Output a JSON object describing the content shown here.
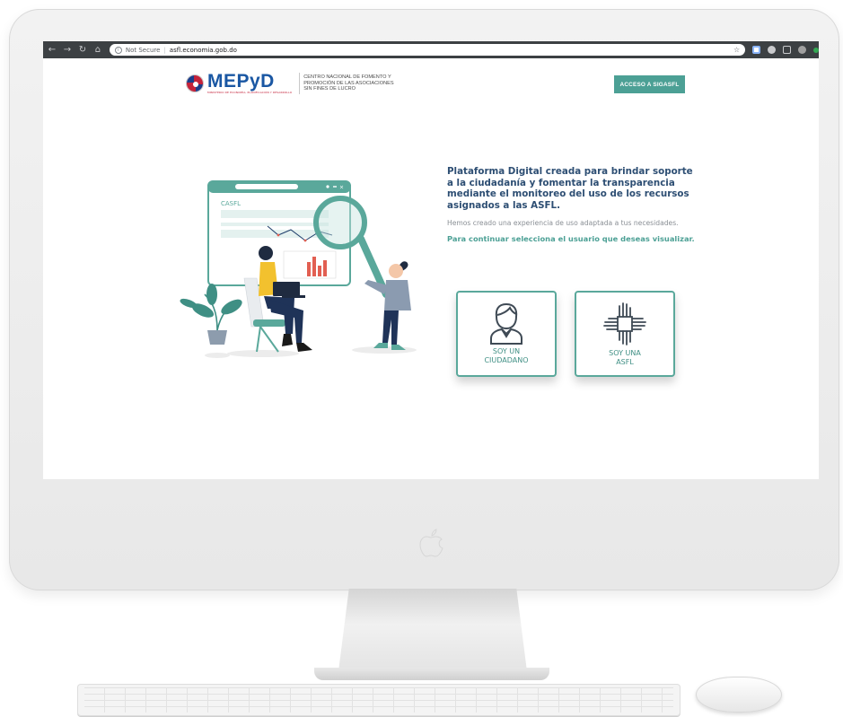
{
  "browser": {
    "security": "Not Secure",
    "url": "asfl.economia.gob.do",
    "nav_icons": [
      "back-arrow-icon",
      "forward-arrow-icon",
      "reload-icon",
      "home-icon"
    ]
  },
  "header": {
    "brand_name": "MEPyD",
    "brand_sub": "MINISTERIO DE ECONOMÍA, PLANIFICACIÓN Y DESARROLLO",
    "centro_lines": [
      "CENTRO NACIONAL DE FOMENTO Y",
      "PROMOCIÓN DE LAS ASOCIACIONES",
      "SIN FINES DE LUCRO"
    ],
    "acceso_label": "ACCESO A SIGASFL"
  },
  "illustration": {
    "window_label": "CASFL"
  },
  "main": {
    "headline": "Plataforma Digital creada para brindar soporte a la ciudadanía y fomentar la transparencia mediante el monitoreo del uso de los recursos asignados a las ASFL.",
    "description": "Hemos creado una experiencia de uso adaptada a tus necesidades.",
    "instruction": "Para continuar selecciona el usuario que deseas visualizar."
  },
  "cards": [
    {
      "line1": "SOY UN",
      "line2": "CIUDADANO",
      "icon": "person-icon"
    },
    {
      "line1": "SOY UNA",
      "line2": "ASFL",
      "icon": "joined-hands-icon"
    }
  ],
  "colors": {
    "accent": "#4ca095",
    "headline": "#2d4e73",
    "brand_blue": "#1a57a3",
    "brand_red": "#c4233a"
  }
}
